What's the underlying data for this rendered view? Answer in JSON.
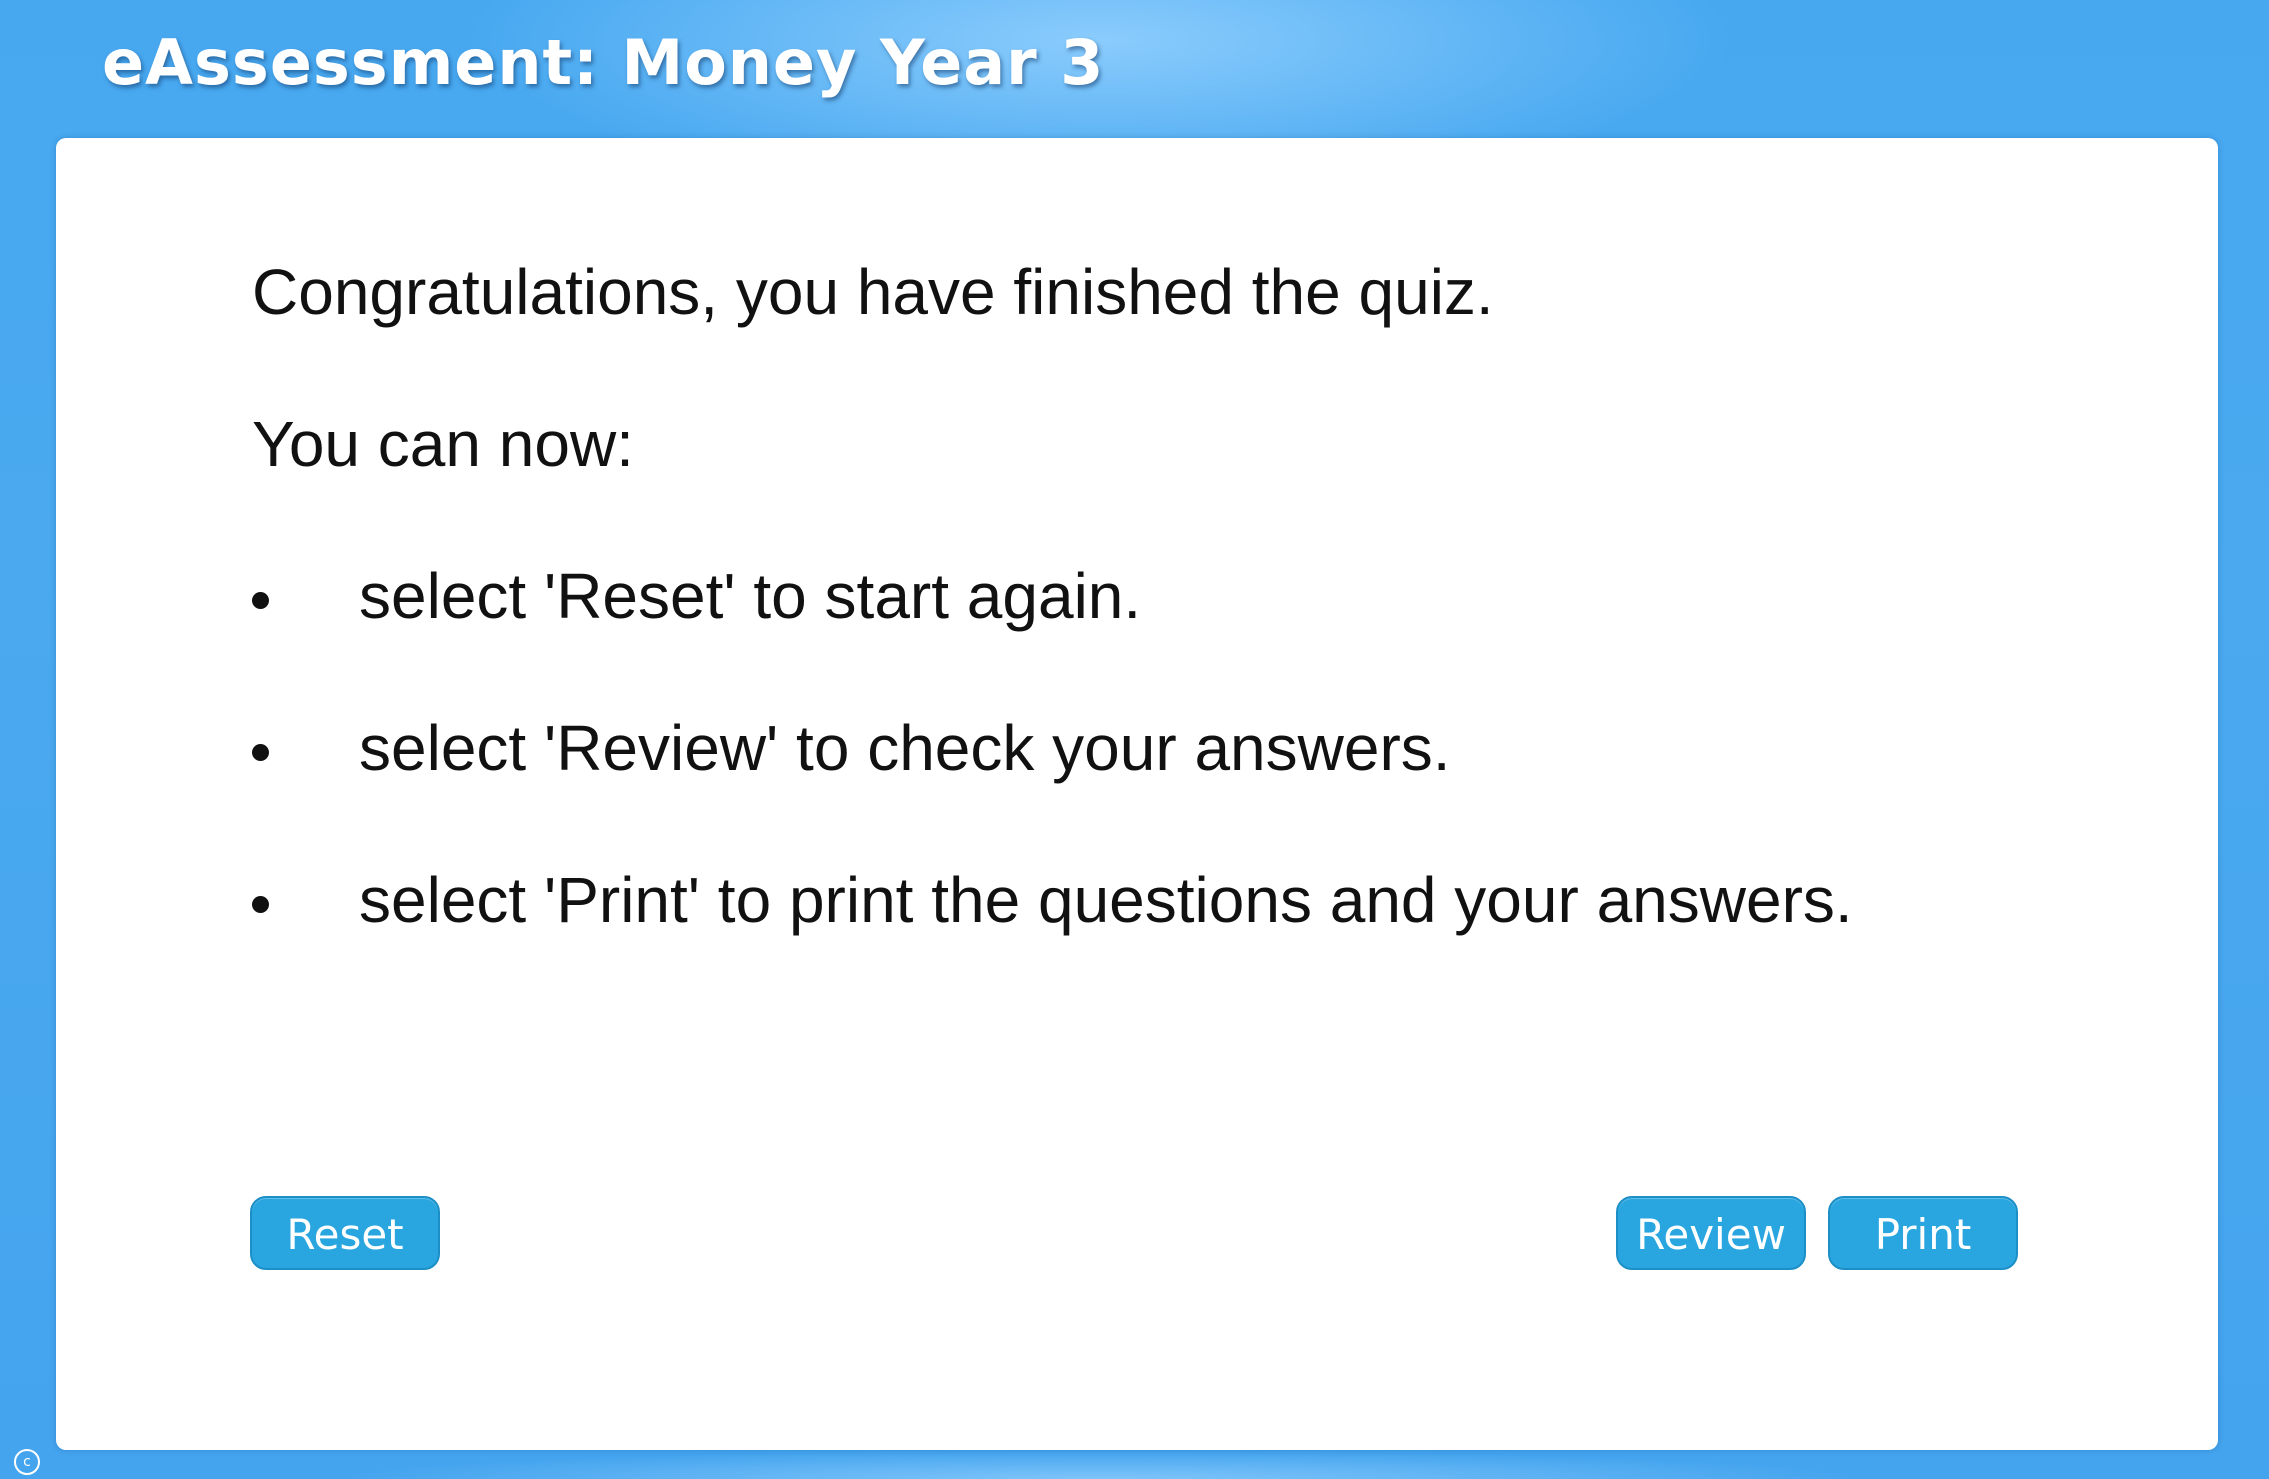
{
  "header": {
    "title": "eAssessment: Money Year 3"
  },
  "main": {
    "congrats": "Congratulations, you have finished the quiz.",
    "prompt": "You can now:",
    "options": [
      "select 'Reset' to start again.",
      "select 'Review' to check your answers.",
      "select 'Print' to print the questions and your answers."
    ]
  },
  "buttons": {
    "reset": "Reset",
    "review": "Review",
    "print": "Print"
  },
  "footer": {
    "copyright_symbol": "c",
    "copyright_icon": "copyright-icon"
  },
  "colors": {
    "background": "#47a8f0",
    "panel": "#ffffff",
    "button": "#29a6e0",
    "button_text": "#ffffff",
    "body_text": "#111111"
  }
}
